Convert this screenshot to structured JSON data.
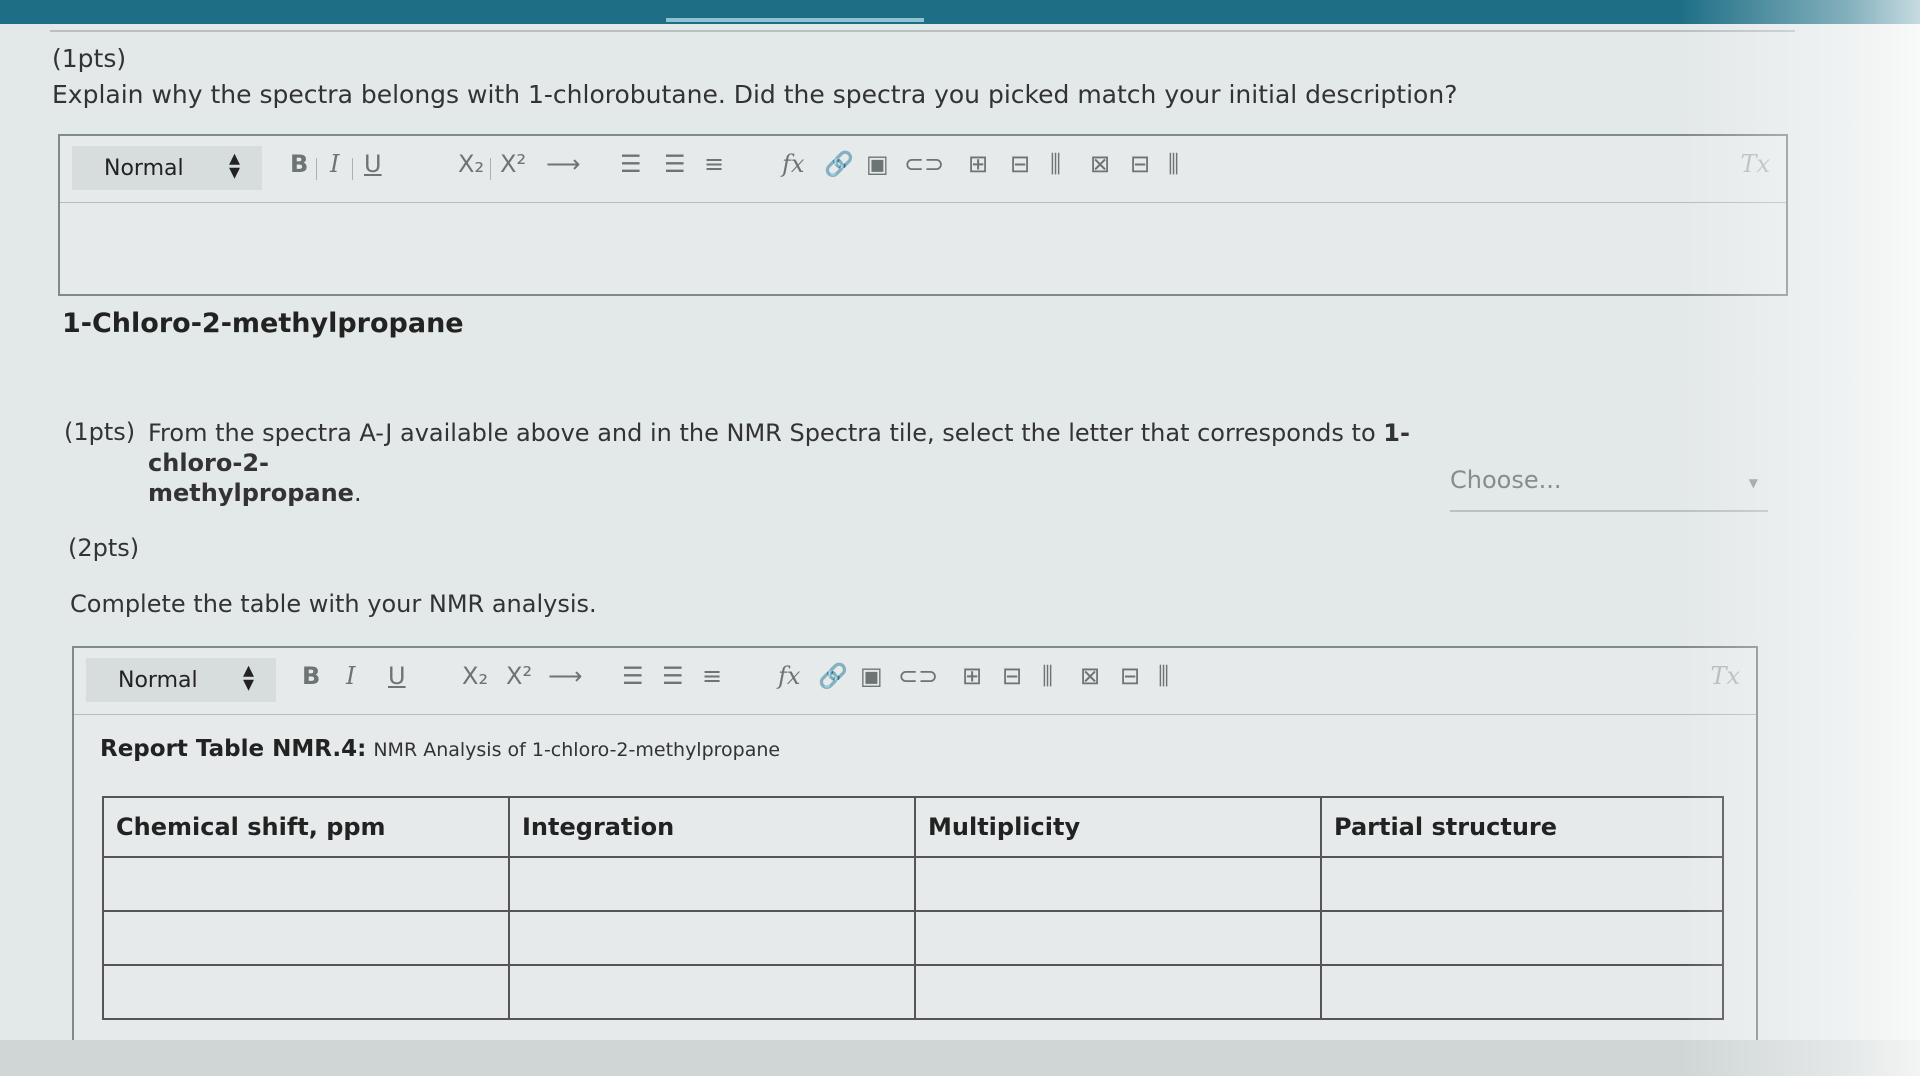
{
  "q1": {
    "points": "(1pts)",
    "text": "Explain why the spectra belongs with 1-chlorobutane. Did the spectra you picked match your initial description?"
  },
  "editor1": {
    "format": "Normal"
  },
  "section": {
    "title": "1-Chloro-2-methylpropane"
  },
  "q2": {
    "points": "(1pts)",
    "text_line1": "From the spectra A-J available above and in the NMR Spectra tile, select the letter that corresponds to",
    "compound_part1": "1-chloro-2-",
    "compound_part2": "methylpropane",
    "text_end": ".",
    "select_placeholder": "Choose..."
  },
  "q3": {
    "points": "(2pts)",
    "text": "Complete the table with your NMR analysis."
  },
  "editor2": {
    "format": "Normal",
    "caption_bold": "Report Table NMR.4:",
    "caption_rest": "NMR Analysis of 1-chloro-2-methylpropane",
    "table": {
      "headers": [
        "Chemical shift, ppm",
        "Integration",
        "Multiplicity",
        "Partial structure"
      ],
      "rows": [
        [
          "",
          "",
          "",
          ""
        ],
        [
          "",
          "",
          "",
          ""
        ],
        [
          "",
          "",
          "",
          ""
        ]
      ]
    }
  },
  "toolbar": {
    "bold": "B",
    "italic": "I",
    "underline": "U",
    "subscript": "X₂",
    "superscript": "X²",
    "arrow": "⟶",
    "list_ordered": "☰",
    "list_bullet": "☰",
    "align": "≡",
    "formula": "fx",
    "link": "🔗",
    "image": "▣",
    "attach": "⊂⊃",
    "table": "⊞",
    "row": "⊟",
    "col": "⫼",
    "merge": "⊠",
    "delete_row": "⊟",
    "delete_col": "⫼",
    "clear": "Tx"
  },
  "colors": {
    "topbar": "#1e6f86",
    "text": "#333333",
    "border": "#7f8a8d"
  }
}
